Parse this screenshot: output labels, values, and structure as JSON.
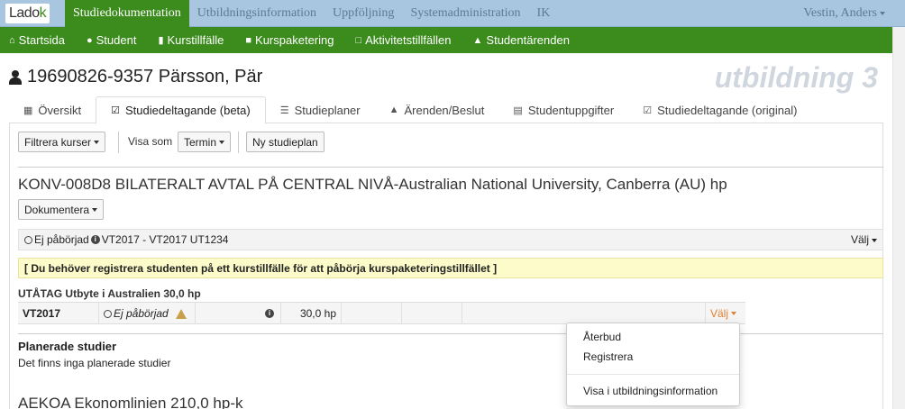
{
  "topbar": {
    "logo_part1": "Lado",
    "logo_part2": "k",
    "nav": [
      "Studiedokumentation",
      "Utbildningsinformation",
      "Uppföljning",
      "Systemadministration",
      "IK"
    ],
    "user": "Vestin, Anders"
  },
  "subnav": [
    "Startsida",
    "Student",
    "Kurstillfälle",
    "Kurspaketering",
    "Aktivitetstillfällen",
    "Studentärenden"
  ],
  "student": {
    "title": "19690826-9357 Pärsson, Pär",
    "environment": "utbildning 3"
  },
  "tabs": [
    "Översikt",
    "Studiedeltagande (beta)",
    "Studieplaner",
    "Ärenden/Beslut",
    "Studentuppgifter",
    "Studiedeltagande (original)"
  ],
  "toolbar": {
    "filter_label": "Filtrera kurser",
    "visa_som_label": "Visa som",
    "termin_label": "Termin",
    "new_plan_label": "Ny studieplan"
  },
  "program": {
    "heading": "KONV-008D8 BILATERALT AVTAL PÅ CENTRAL NIVÅ-Australian National University, Canberra (AU) hp",
    "dokumentera_label": "Dokumentera",
    "status_text": "Ej påbörjad",
    "period_text": "VT2017 - VT2017 UT1234",
    "valj_label": "Välj",
    "warning": "[ Du behöver registrera studenten på ett kurstillfälle för att påbörja kurspaketeringstillfället ]"
  },
  "utatag": {
    "heading": "UTÅTAG Utbyte i Australien 30,0 hp",
    "row": {
      "term": "VT2017",
      "status": "Ej påbörjad",
      "credits": "30,0 hp",
      "valj_label": "Välj"
    }
  },
  "planned": {
    "heading": "Planerade studier",
    "text": "Det finns inga planerade studier"
  },
  "next_program": {
    "heading": "AEKOA Ekonomlinien 210,0 hp-k"
  },
  "menu": {
    "items": [
      "Återbud",
      "Registrera",
      "Visa i utbildningsinformation"
    ]
  },
  "colors": {
    "topbar": "#a8c6e0",
    "brand_green": "#3b8b1d",
    "warning_bg": "#fdfbc9",
    "accent_orange": "#e08030"
  }
}
